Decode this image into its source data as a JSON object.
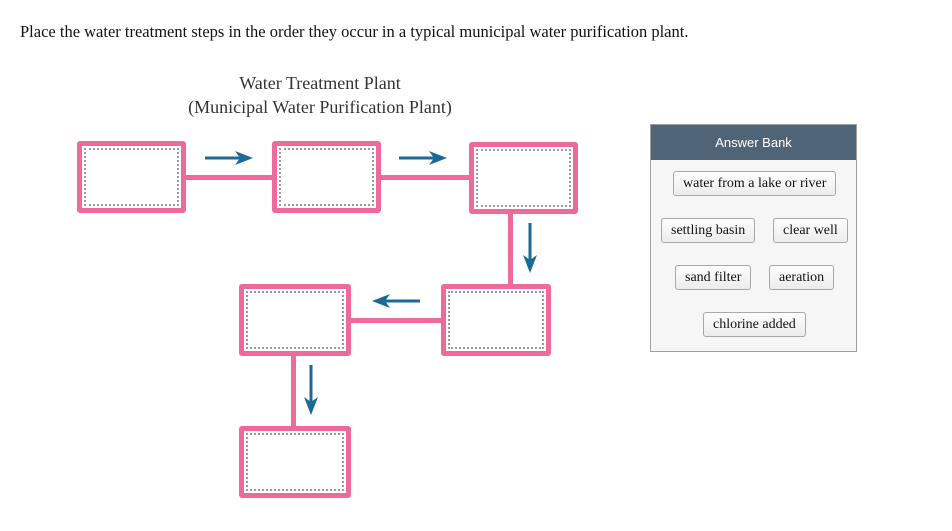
{
  "prompt": "Place the water treatment steps in the order they occur in a typical municipal water purification plant.",
  "diagram": {
    "title_line1": "Water Treatment Plant",
    "title_line2": "(Municipal Water Purification Plant)",
    "slots": [
      {
        "step": 1,
        "value": ""
      },
      {
        "step": 2,
        "value": ""
      },
      {
        "step": 3,
        "value": ""
      },
      {
        "step": 4,
        "value": ""
      },
      {
        "step": 5,
        "value": ""
      },
      {
        "step": 6,
        "value": ""
      }
    ],
    "colors": {
      "box_border": "#ee6a9a",
      "arrow": "#1b6a96"
    }
  },
  "answer_bank": {
    "title": "Answer Bank",
    "header_color": "#506478",
    "items": [
      {
        "label": "water from a lake or river"
      },
      {
        "label": "settling basin"
      },
      {
        "label": "clear well"
      },
      {
        "label": "sand filter"
      },
      {
        "label": "aeration"
      },
      {
        "label": "chlorine added"
      }
    ]
  }
}
